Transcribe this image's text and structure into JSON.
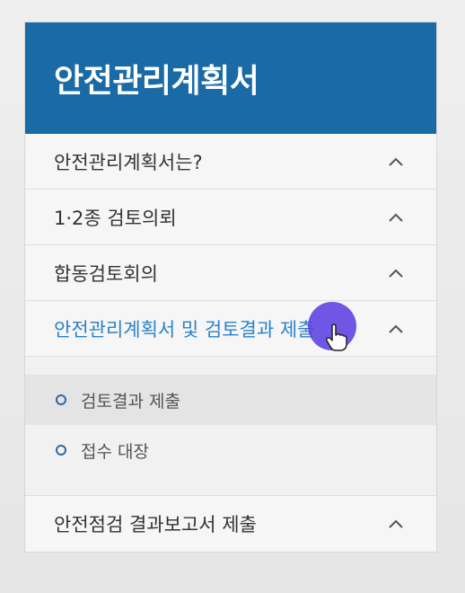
{
  "panel": {
    "title": "안전관리계획서",
    "header_color": "#1a6aa5",
    "items": [
      {
        "label": "안전관리계획서는?",
        "icon": "chevron-up-icon"
      },
      {
        "label": "1·2종 검토의뢰",
        "icon": "chevron-up-icon"
      },
      {
        "label": "합동검토회의",
        "icon": "chevron-up-icon"
      },
      {
        "label": "안전관리계획서 및 검토결과 제출",
        "icon": "chevron-up-icon",
        "active": true
      },
      {
        "label": "안전점검 결과보고서 제출",
        "icon": "chevron-up-icon"
      }
    ],
    "submenu": [
      {
        "label": "검토결과 제출",
        "icon": "bullet-icon"
      },
      {
        "label": "접수 대장",
        "icon": "bullet-icon"
      }
    ],
    "active_color": "#2b82c9"
  },
  "cursor": {
    "icon": "hand-cursor-icon",
    "highlight_color": "#583ae0"
  }
}
